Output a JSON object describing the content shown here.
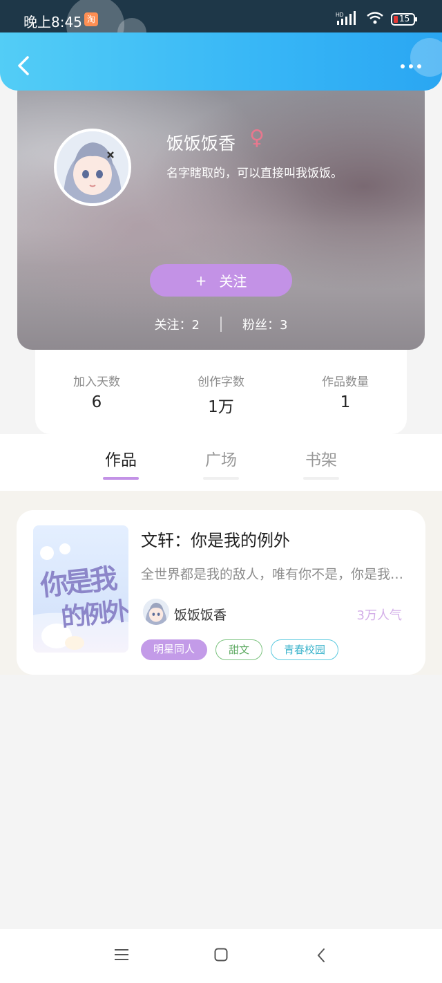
{
  "status_bar": {
    "time": "晚上8:45",
    "app_badge": "淘",
    "network": "HD",
    "battery": "15"
  },
  "header": {
    "back_icon": "chevron-left-icon",
    "more_icon": "more-horizontal-icon"
  },
  "profile": {
    "name": "饭饭饭香",
    "gender_symbol": "♀",
    "bio": "名字瞎取的，可以直接叫我饭饭。",
    "follow_button": {
      "plus": "+",
      "label": "关注"
    },
    "following": "关注：2",
    "fans": "粉丝：3"
  },
  "stats": [
    {
      "label": "加入天数",
      "value": "6"
    },
    {
      "label": "创作字数",
      "value": "1万"
    },
    {
      "label": "作品数量",
      "value": "1"
    }
  ],
  "tabs": [
    {
      "label": "作品",
      "active": true
    },
    {
      "label": "广场",
      "active": false
    },
    {
      "label": "书架",
      "active": false
    }
  ],
  "works": [
    {
      "title": "文轩：你是我的例外",
      "description": "全世界都是我的敌人，唯有你不是，你是我的例外",
      "author": "饭饭饭香",
      "popularity": "3万人气",
      "cover_text": {
        "line1": "你是我",
        "line2": "的例外"
      },
      "tags": [
        {
          "label": "明星同人",
          "style": "filled",
          "color": "#c39be8"
        },
        {
          "label": "甜文",
          "style": "outline",
          "color": "#7bc37e"
        },
        {
          "label": "青春校园",
          "style": "outline",
          "color": "#5ac9df"
        }
      ]
    }
  ],
  "colors": {
    "accent": "#c392e6",
    "header_start": "#53cdf6",
    "header_end": "#2aa6f2",
    "gender": "#e8788e"
  }
}
